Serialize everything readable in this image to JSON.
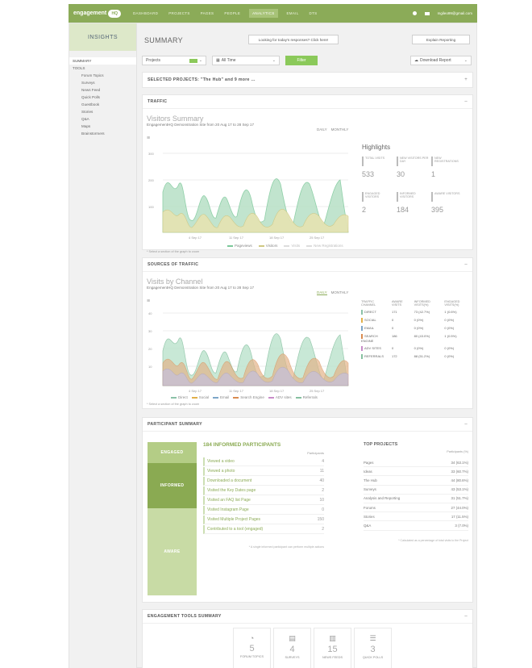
{
  "topbar": {
    "logo_text": "engagement",
    "logo_badge": "HQ",
    "nav": [
      "DASHBOARD",
      "PROJECTS",
      "PAGES",
      "PEOPLE",
      "ANALYTICS",
      "EMAIL",
      "DTS"
    ],
    "active_nav": "ANALYTICS",
    "user_email": "mgileo99@gmail.com"
  },
  "sidebar": {
    "heading": "INSIGHTS",
    "summary_label": "SUMMARY",
    "tools_label": "TOOLS",
    "items": [
      "Forum Topics",
      "Surveys",
      "News Feed",
      "Quick Polls",
      "Guestbook",
      "Stories",
      "Q&A",
      "Maps",
      "Brainstormers"
    ]
  },
  "header": {
    "title": "SUMMARY",
    "response_button": "Looking for today's responses? Click here!",
    "explain_button": "Explain Reporting"
  },
  "filters": {
    "projects_label": "Projects",
    "time_label": "All Time",
    "filter_button": "Filter",
    "download_label": "Download Report"
  },
  "selected_projects": "SELECTED PROJECTS: \"The Hub\" and 9 more ...",
  "traffic": {
    "section_title": "TRAFFIC",
    "chart_title": "Visitors Summary",
    "subtitle": "EngagementHQ Demonstration Site from 20 Aug 17 to 28 Sep 17",
    "daily": "DAILY",
    "monthly": "MONTHLY",
    "select_hint": "* Select a section of the graph to zoom",
    "legend": [
      "Pageviews",
      "Visitors",
      "Visits",
      "New Registrations"
    ],
    "x_ticks": [
      "4 Sep 17",
      "11 Sep 17",
      "18 Sep 17",
      "25 Sep 17"
    ],
    "y_ticks": [
      "300",
      "200",
      "100"
    ]
  },
  "highlights": {
    "title": "Highlights",
    "items": [
      {
        "label": "TOTAL VISITS",
        "value": "533"
      },
      {
        "label": "NEW VISITORS PER DAY",
        "value": "30"
      },
      {
        "label": "NEW REGISTRATIONS",
        "value": "1"
      },
      {
        "label": "ENGAGED VISITORS",
        "value": "2"
      },
      {
        "label": "INFORMED VISITORS",
        "value": "184"
      },
      {
        "label": "AWARE VISITORS",
        "value": "395"
      }
    ]
  },
  "sources": {
    "section_title": "SOURCES OF TRAFFIC",
    "chart_title": "Visits by Channel",
    "subtitle": "EngagementHQ Demonstration Site from 20 Aug 17 to 28 Sep 17",
    "daily": "DAILY",
    "monthly": "MONTHLY",
    "select_hint": "* Select a section of the graph to zoom",
    "legend": [
      "Direct",
      "Social",
      "Email",
      "Search Engine",
      "ADV sites",
      "Referrals"
    ],
    "x_ticks": [
      "4 Sep 17",
      "11 Sep 17",
      "18 Sep 17",
      "25 Sep 17"
    ],
    "y_ticks": [
      "40",
      "30",
      "20",
      "10"
    ],
    "table_headers": [
      "TRAFFIC CHANNEL",
      "AWARE VISITS",
      "INFORMED VISITS(%)",
      "ENGAGED VISITS(%)"
    ],
    "rows": [
      {
        "channel": "DIRECT",
        "aware": "171",
        "informed": "73 (42.7%)",
        "engaged": "1 (0.6%)",
        "color": "#8bc2a8"
      },
      {
        "channel": "SOCIAL",
        "aware": "0",
        "informed": "0 (0%)",
        "engaged": "0 (0%)",
        "color": "#e2b04a"
      },
      {
        "channel": "EMAIL",
        "aware": "0",
        "informed": "0 (0%)",
        "engaged": "0 (0%)",
        "color": "#7da6c8"
      },
      {
        "channel": "SEARCH ENGINE",
        "aware": "186",
        "informed": "80 (43.0%)",
        "engaged": "1 (0.5%)",
        "color": "#d98b50"
      },
      {
        "channel": "ADV SITES",
        "aware": "0",
        "informed": "0 (0%)",
        "engaged": "0 (0%)",
        "color": "#c88cc8"
      },
      {
        "channel": "REFERRALS",
        "aware": "172",
        "informed": "88 (51.2%)",
        "engaged": "0 (0%)",
        "color": "#86c0a0"
      }
    ]
  },
  "participants": {
    "section_title": "PARTICIPANT SUMMARY",
    "tabs": [
      "ENGAGED",
      "INFORMED",
      "AWARE"
    ],
    "active_tab": "INFORMED",
    "informed_count_title": "184 INFORMED PARTICIPANTS",
    "participants_col": "Participants",
    "rows": [
      {
        "label": "Viewed a video",
        "value": "4"
      },
      {
        "label": "Viewed a photo",
        "value": "11"
      },
      {
        "label": "Downloaded a document",
        "value": "40"
      },
      {
        "label": "Visited the Key Dates page",
        "value": "2"
      },
      {
        "label": "Visited an FAQ list Page",
        "value": "10"
      },
      {
        "label": "Visited Instagram Page",
        "value": "0"
      },
      {
        "label": "Visited Multiple Project Pages",
        "value": "150"
      },
      {
        "label": "Contributed to a tool (engaged)",
        "value": "2"
      }
    ],
    "footnote": "* A single informed participant can perform multiple actions",
    "top_projects_title": "TOP PROJECTS",
    "top_projects_col": "Participants (%)",
    "top_projects": [
      {
        "name": "Pages",
        "value": "34 (63.1%)"
      },
      {
        "name": "Ideas",
        "value": "33 (60.7%)"
      },
      {
        "name": "The Hub",
        "value": "44 (80.6%)"
      },
      {
        "name": "Surveys",
        "value": "43 (53.1%)"
      },
      {
        "name": "Analysis and Reporting",
        "value": "31 (51.7%)"
      },
      {
        "name": "Forums",
        "value": "27 (44.0%)"
      },
      {
        "name": "Stories",
        "value": "17 (11.5%)"
      },
      {
        "name": "Q&A",
        "value": "3 (7.0%)"
      }
    ],
    "top_footnote": "* Calculated as a percentage of total visits to the Project"
  },
  "tools_summary": {
    "section_title": "ENGAGEMENT TOOLS SUMMARY",
    "tools": [
      {
        "icon": "forum-icon",
        "glyph": "◔",
        "value": "5",
        "label": "FORUM TOPICS",
        "color": "#e8758a"
      },
      {
        "icon": "survey-icon",
        "glyph": "▤",
        "value": "4",
        "label": "SURVEYS",
        "color": "#5fc5b0"
      },
      {
        "icon": "newsfeed-icon",
        "glyph": "▥",
        "value": "15",
        "label": "NEWS FEEDS",
        "color": "#efe168"
      },
      {
        "icon": "quickpoll-icon",
        "glyph": "☰",
        "value": "3",
        "label": "QUICK POLLS",
        "color": "#9fc9e6"
      }
    ]
  },
  "colors": {
    "brand_green": "#8bab58",
    "accent_green": "#8bc95a",
    "informed_tab": "#8aaa52",
    "engaged_tab": "#b4cd86",
    "aware_tab": "#c8dba5"
  }
}
